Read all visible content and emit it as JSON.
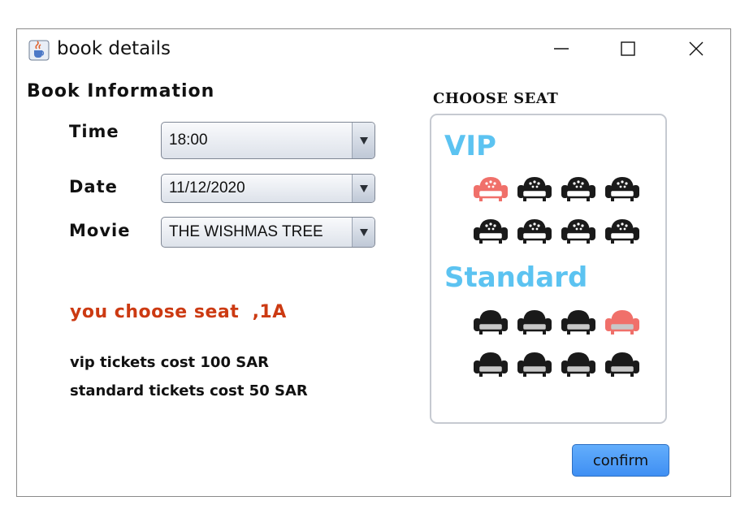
{
  "window": {
    "title": "book details",
    "icon": "java-cup-icon"
  },
  "form": {
    "section_title": "Book Information",
    "time_label": "Time",
    "time_value": "18:00",
    "date_label": "Date",
    "date_value": "11/12/2020",
    "movie_label": "Movie",
    "movie_value": "THE WISHMAS TREE"
  },
  "selection_text": "you choose seat  ,1A",
  "prices": {
    "vip": "vip tickets cost 100 SAR",
    "standard": "standard tickets cost 50 SAR"
  },
  "seats": {
    "heading": "CHOOSE SEAT",
    "vip_label": "VIP",
    "standard_label": "Standard",
    "vip_rows": [
      [
        {
          "state": "selected"
        },
        {
          "state": "available"
        },
        {
          "state": "available"
        },
        {
          "state": "available"
        }
      ],
      [
        {
          "state": "available"
        },
        {
          "state": "available"
        },
        {
          "state": "available"
        },
        {
          "state": "available"
        }
      ]
    ],
    "standard_rows": [
      [
        {
          "state": "available"
        },
        {
          "state": "available"
        },
        {
          "state": "available"
        },
        {
          "state": "selected"
        }
      ],
      [
        {
          "state": "available"
        },
        {
          "state": "available"
        },
        {
          "state": "available"
        },
        {
          "state": "available"
        }
      ]
    ]
  },
  "colors": {
    "selected_seat": "#f0706a",
    "available_seat": "#1a1a1a",
    "category_label": "#5cc3f1",
    "selection_text": "#cc3a12",
    "confirm_button": "#4a97f5"
  },
  "buttons": {
    "confirm": "confirm"
  }
}
